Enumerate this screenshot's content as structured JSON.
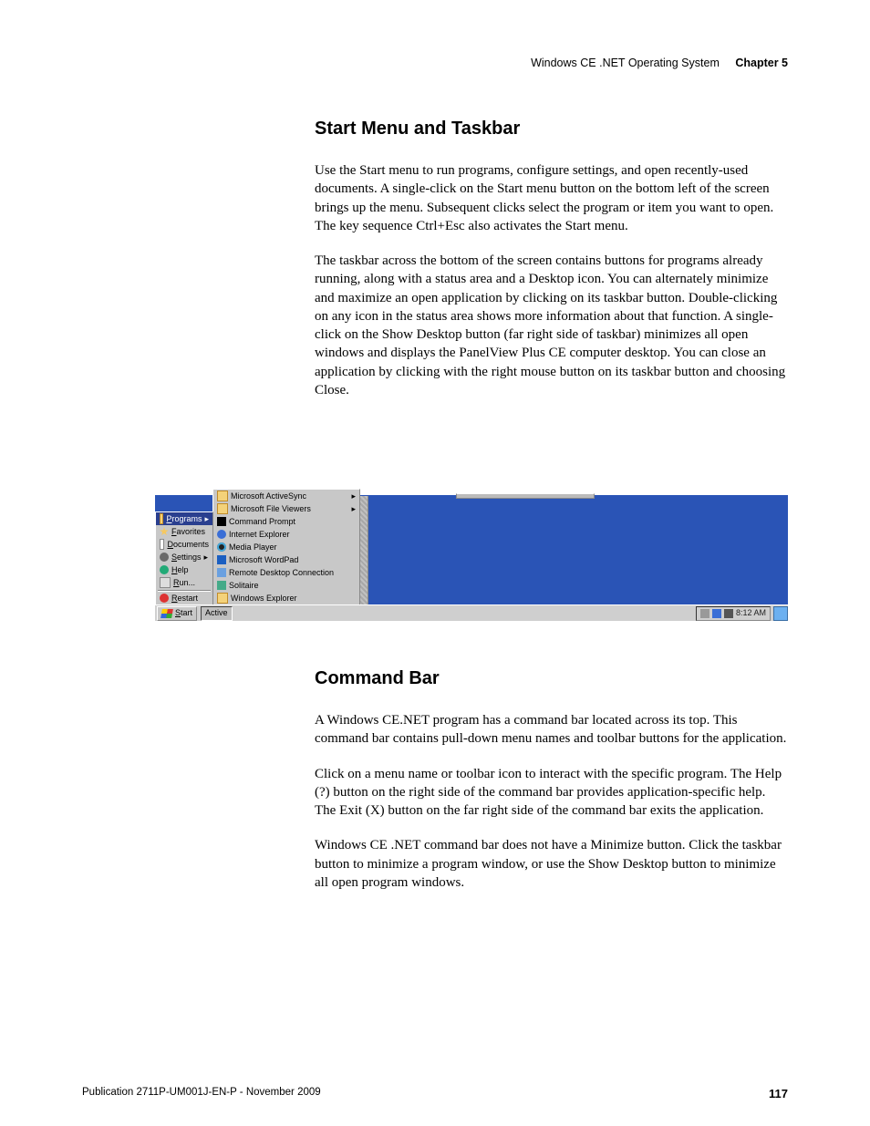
{
  "header": {
    "breadcrumb": "Windows CE .NET Operating System",
    "chapter": "Chapter 5"
  },
  "sec1": {
    "title": "Start Menu and Taskbar",
    "p1": "Use the Start menu to run programs, configure settings, and open recently-used documents. A single-click on the Start menu button on the bottom left of the screen brings up the menu. Subsequent clicks select the program or item you want to open. The key sequence Ctrl+Esc also activates the Start menu.",
    "p2": "The taskbar across the bottom of the screen contains buttons for programs already running, along with a status area and a Desktop icon. You can alternately minimize and maximize an open application by clicking on its taskbar button. Double-clicking on any icon in the status area shows more information about that function. A single-click on the Show Desktop button (far right side of taskbar) minimizes all open windows and displays the PanelView Plus CE computer desktop. You can close an application by clicking with the right mouse button on its taskbar button and choosing Close."
  },
  "sec2": {
    "title": "Command Bar",
    "p1": "A Windows CE.NET program has a command bar located across its top. This command bar contains pull-down menu names and toolbar buttons for the application.",
    "p2": "Click on a menu name or toolbar icon to interact with the specific program. The Help (?) button on the right side of the command bar provides application-specific help. The Exit (X) button on the far right side of the command bar exits the application.",
    "p3": "Windows CE .NET command bar does not have a Minimize button. Click the taskbar button to minimize a program window, or use the Show Desktop button to minimize all open program windows."
  },
  "wce": {
    "startMenu": [
      {
        "icon": "folder",
        "label": "Programs",
        "hi": true,
        "arrow": true
      },
      {
        "icon": "star",
        "label": "Favorites"
      },
      {
        "icon": "doc",
        "label": "Documents"
      },
      {
        "icon": "gear",
        "label": "Settings",
        "arrow": true
      },
      {
        "icon": "help",
        "label": "Help"
      },
      {
        "icon": "run",
        "label": "Run..."
      },
      {
        "sep": true
      },
      {
        "icon": "restart",
        "label": "Restart"
      }
    ],
    "programsMenu": [
      {
        "icon": "folder",
        "label": "Microsoft ActiveSync",
        "arrow": true
      },
      {
        "icon": "folder",
        "label": "Microsoft File Viewers",
        "arrow": true
      },
      {
        "icon": "cmd",
        "label": "Command Prompt"
      },
      {
        "icon": "ie",
        "label": "Internet Explorer"
      },
      {
        "icon": "mp",
        "label": "Media Player"
      },
      {
        "icon": "wp",
        "label": "Microsoft WordPad"
      },
      {
        "icon": "rdc",
        "label": "Remote Desktop Connection"
      },
      {
        "icon": "sol",
        "label": "Solitaire"
      },
      {
        "icon": "we",
        "label": "Windows Explorer"
      }
    ],
    "taskbar": {
      "start": "Start",
      "running": "Active",
      "clock": "8:12 AM"
    }
  },
  "footer": {
    "pub": "Publication 2711P-UM001J-EN-P - November 2009",
    "page": "117"
  }
}
